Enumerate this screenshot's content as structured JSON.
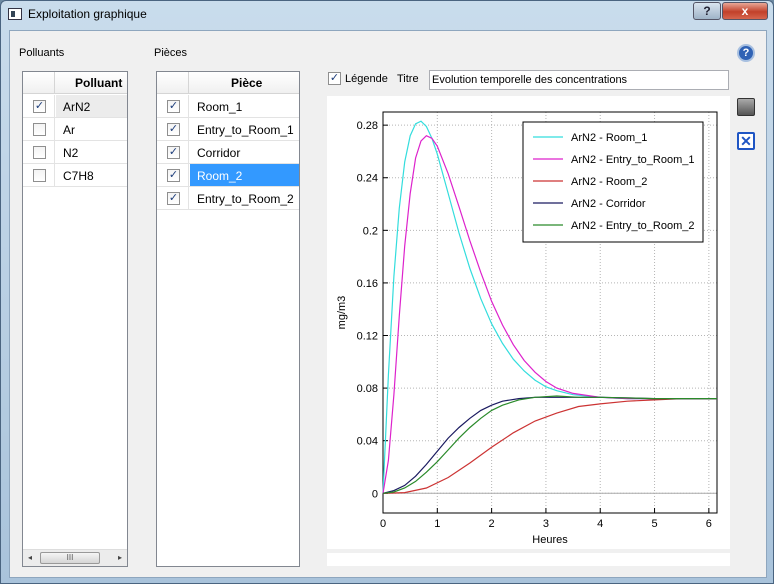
{
  "window": {
    "title": "Exploitation graphique",
    "help_label": "?",
    "close_label": "x"
  },
  "pollutants": {
    "section_label": "Polluants",
    "column_header": "Polluant",
    "items": [
      {
        "name": "ArN2",
        "checked": true
      },
      {
        "name": "Ar",
        "checked": false
      },
      {
        "name": "N2",
        "checked": false
      },
      {
        "name": "C7H8",
        "checked": false
      }
    ],
    "scroll_thumb_label": "III"
  },
  "rooms": {
    "section_label": "Pièces",
    "column_header": "Pièce",
    "items": [
      {
        "name": "Room_1",
        "checked": true
      },
      {
        "name": "Entry_to_Room_1",
        "checked": true
      },
      {
        "name": "Corridor",
        "checked": true
      },
      {
        "name": "Room_2",
        "checked": true,
        "selected": true
      },
      {
        "name": "Entry_to_Room_2",
        "checked": true
      }
    ]
  },
  "graph_options": {
    "legend_label": "Légende",
    "legend_checked": true,
    "title_label": "Titre",
    "title_value": "Evolution temporelle des concentrations"
  },
  "chart_data": {
    "type": "line",
    "title": "",
    "xlabel": "Heures",
    "ylabel": "mg/m3",
    "xlim": [
      0,
      6.15
    ],
    "ylim": [
      -0.015,
      0.29
    ],
    "x_ticks": [
      0,
      1,
      2,
      3,
      4,
      5,
      6
    ],
    "y_ticks": [
      0,
      0.04,
      0.08,
      0.12,
      0.16,
      0.2,
      0.24,
      0.28
    ],
    "y_tick_labels": [
      "0",
      "0.04",
      "0.08",
      "0.12",
      "0.16",
      "0.2",
      "0.24",
      "0.28"
    ],
    "grid": true,
    "legend_position": "top-right",
    "series": [
      {
        "name": "ArN2 - Room_1",
        "color": "#33dddd",
        "x": [
          0,
          0.1,
          0.2,
          0.3,
          0.4,
          0.5,
          0.6,
          0.7,
          0.8,
          0.9,
          1.0,
          1.2,
          1.4,
          1.6,
          1.8,
          2.0,
          2.2,
          2.4,
          2.6,
          2.8,
          3.0,
          3.2,
          3.5,
          4.0,
          4.5,
          5.0,
          5.5,
          6.0,
          6.15
        ],
        "y": [
          0,
          0.09,
          0.165,
          0.217,
          0.252,
          0.272,
          0.281,
          0.283,
          0.279,
          0.27,
          0.258,
          0.228,
          0.198,
          0.171,
          0.148,
          0.129,
          0.114,
          0.102,
          0.093,
          0.086,
          0.081,
          0.078,
          0.075,
          0.073,
          0.072,
          0.072,
          0.072,
          0.072,
          0.072
        ]
      },
      {
        "name": "ArN2 - Entry_to_Room_1",
        "color": "#dd22cc",
        "x": [
          0,
          0.1,
          0.2,
          0.3,
          0.4,
          0.5,
          0.6,
          0.7,
          0.8,
          0.9,
          1.0,
          1.2,
          1.4,
          1.6,
          1.8,
          2.0,
          2.2,
          2.4,
          2.6,
          2.8,
          3.0,
          3.2,
          3.5,
          4.0,
          4.5,
          5.0,
          5.5,
          6.0,
          6.15
        ],
        "y": [
          0,
          0.025,
          0.075,
          0.135,
          0.188,
          0.228,
          0.255,
          0.268,
          0.272,
          0.27,
          0.264,
          0.243,
          0.218,
          0.192,
          0.168,
          0.146,
          0.128,
          0.113,
          0.101,
          0.092,
          0.085,
          0.08,
          0.076,
          0.073,
          0.072,
          0.072,
          0.072,
          0.072,
          0.072
        ]
      },
      {
        "name": "ArN2 - Room_2",
        "color": "#cc3333",
        "x": [
          0,
          0.4,
          0.8,
          1.2,
          1.6,
          2.0,
          2.4,
          2.8,
          3.2,
          3.6,
          4.0,
          4.5,
          5.0,
          5.5,
          6.0,
          6.15
        ],
        "y": [
          0,
          0.0005,
          0.004,
          0.012,
          0.023,
          0.035,
          0.046,
          0.055,
          0.061,
          0.066,
          0.068,
          0.07,
          0.071,
          0.072,
          0.072,
          0.072
        ]
      },
      {
        "name": "ArN2 - Corridor",
        "color": "#1a1a60",
        "x": [
          0,
          0.2,
          0.4,
          0.6,
          0.8,
          1.0,
          1.2,
          1.4,
          1.6,
          1.8,
          2.0,
          2.2,
          2.5,
          2.8,
          3.2,
          3.6,
          4.0,
          5.0,
          6.0,
          6.15
        ],
        "y": [
          0,
          0.002,
          0.006,
          0.013,
          0.022,
          0.032,
          0.042,
          0.05,
          0.057,
          0.063,
          0.067,
          0.07,
          0.072,
          0.073,
          0.073,
          0.073,
          0.073,
          0.072,
          0.072,
          0.072
        ]
      },
      {
        "name": "ArN2 - Entry_to_Room_2",
        "color": "#2a8a2a",
        "x": [
          0,
          0.2,
          0.4,
          0.6,
          0.8,
          1.0,
          1.2,
          1.4,
          1.6,
          1.8,
          2.0,
          2.2,
          2.5,
          2.8,
          3.2,
          3.6,
          4.0,
          5.0,
          6.0,
          6.15
        ],
        "y": [
          0,
          0.001,
          0.004,
          0.009,
          0.016,
          0.024,
          0.033,
          0.042,
          0.05,
          0.057,
          0.063,
          0.067,
          0.071,
          0.073,
          0.074,
          0.073,
          0.073,
          0.072,
          0.072,
          0.072
        ]
      }
    ]
  }
}
